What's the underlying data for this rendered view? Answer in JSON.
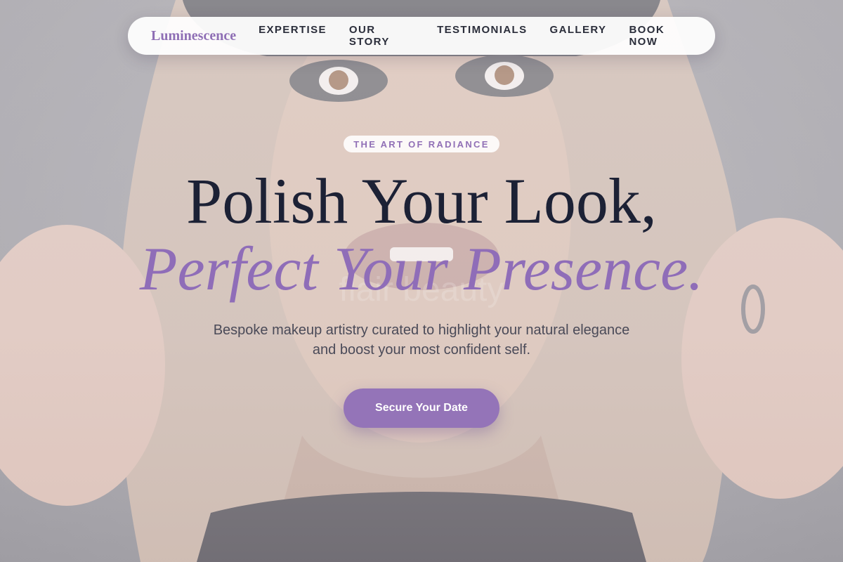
{
  "brand": {
    "name": "Luminescence"
  },
  "nav": {
    "links": [
      "EXPERTISE",
      "OUR STORY",
      "TESTIMONIALS",
      "GALLERY",
      "BOOK NOW"
    ]
  },
  "hero": {
    "eyebrow": "THE ART OF RADIANCE",
    "headline_line1": "Polish Your Look,",
    "headline_line2": "Perfect Your Presence.",
    "subtitle": "Bespoke makeup artistry curated to highlight your natural elegance and boost your most confident self.",
    "cta_label": "Secure Your Date",
    "watermark": "flair beauty"
  },
  "colors": {
    "accent": "#9474b8",
    "heading": "#1c2135",
    "nav_text": "#2a2d3a"
  }
}
